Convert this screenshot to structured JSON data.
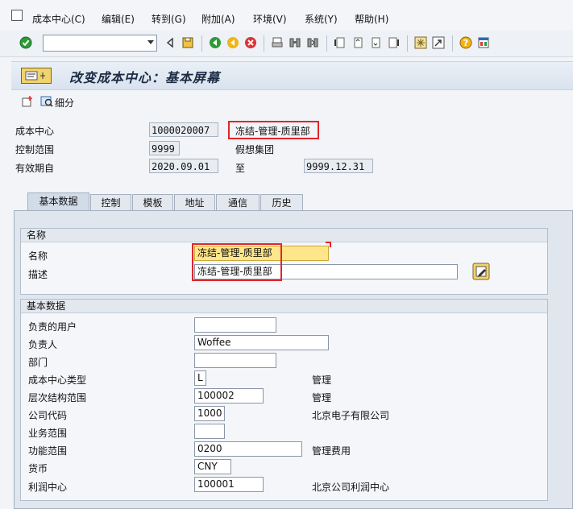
{
  "menu": [
    "成本中心(C)",
    "编辑(E)",
    "转到(G)",
    "附加(A)",
    "环境(V)",
    "系统(Y)",
    "帮助(H)"
  ],
  "toolbar": {
    "command_value": ""
  },
  "title": "改变成本中心：基本屏幕",
  "app_toolbar": {
    "detail_label": "细分"
  },
  "header": {
    "cost_center_label": "成本中心",
    "cost_center_value": "1000020007",
    "cost_center_desc": "冻结-管理-质里部",
    "controlling_area_label": "控制范围",
    "controlling_area_value": "9999",
    "controlling_area_desc": "假想集团",
    "valid_from_label": "有效期自",
    "valid_from_value": "2020.09.01",
    "to_label": "至",
    "valid_to_value": "9999.12.31"
  },
  "tabs": [
    "基本数据",
    "控制",
    "模板",
    "地址",
    "通信",
    "历史"
  ],
  "names_group": {
    "title": "名称",
    "name_label": "名称",
    "name_value": "冻结-管理-质里部",
    "desc_label": "描述",
    "desc_value": "冻结-管理-质里部"
  },
  "basic_group": {
    "title": "基本数据",
    "rows": [
      {
        "label": "负责的用户",
        "value": "",
        "desc": ""
      },
      {
        "label": "负责人",
        "value": "Woffee",
        "desc": ""
      },
      {
        "label": "部门",
        "value": "",
        "desc": ""
      },
      {
        "label": "成本中心类型",
        "value": "L",
        "desc": "管理"
      },
      {
        "label": "层次结构范围",
        "value": "100002",
        "desc": "管理"
      },
      {
        "label": "公司代码",
        "value": "1000",
        "desc": "北京电子有限公司"
      },
      {
        "label": "业务范围",
        "value": "",
        "desc": ""
      },
      {
        "label": "功能范围",
        "value": "0200",
        "desc": "管理费用"
      },
      {
        "label": "货币",
        "value": "CNY",
        "desc": ""
      },
      {
        "label": "利润中心",
        "value": "100001",
        "desc": "北京公司利润中心"
      }
    ]
  }
}
